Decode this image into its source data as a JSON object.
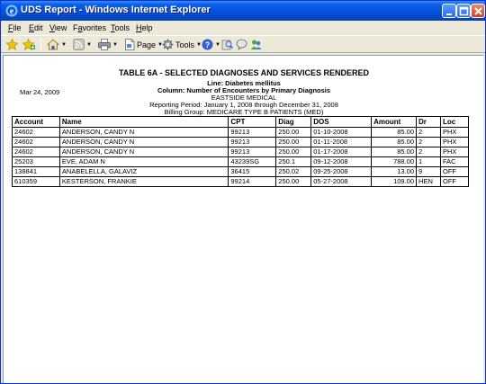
{
  "window": {
    "title": "UDS Report - Windows Internet Explorer"
  },
  "menu": {
    "items": [
      {
        "accel": "F",
        "rest": "ile"
      },
      {
        "accel": "E",
        "rest": "dit"
      },
      {
        "accel": "V",
        "rest": "iew"
      },
      {
        "pre": "F",
        "accel": "a",
        "rest": "vorites"
      },
      {
        "accel": "T",
        "rest": "ools"
      },
      {
        "accel": "H",
        "rest": "elp"
      }
    ]
  },
  "toolbar": {
    "page_label": "Page",
    "tools_label": "Tools"
  },
  "report": {
    "title": "TABLE 6A - SELECTED DIAGNOSES AND SERVICES RENDERED",
    "line": "Line: Diabetes mellitus",
    "column": "Column: Number of Encounters by Primary Diagnosis",
    "org": "EASTSIDE MEDICAL",
    "period": "Reporting Period: January 1, 2008 through December 31, 2008",
    "billing_group": "Billing Group: MEDICARE TYPE B PATIENTS (MED)",
    "date": "Mar 24, 2009",
    "columns": [
      "Account",
      "Name",
      "CPT",
      "Diag",
      "DOS",
      "Amount",
      "Dr",
      "Loc"
    ],
    "rows": [
      [
        "24602",
        "ANDERSON, CANDY N",
        "99213",
        "250.00",
        "01-10-2008",
        "85.00",
        "2",
        "PHX"
      ],
      [
        "24602",
        "ANDERSON, CANDY N",
        "99213",
        "250.00",
        "01-11-2008",
        "85.00",
        "2",
        "PHX"
      ],
      [
        "24602",
        "ANDERSON, CANDY N",
        "99213",
        "250.00",
        "01-17-2008",
        "85.00",
        "2",
        "PHX"
      ],
      [
        "25203",
        "EVE, ADAM N",
        "43239SG",
        "250.1",
        "09-12-2008",
        "788.00",
        "1",
        "FAC"
      ],
      [
        "138841",
        "ANABELELLA, GALAVIZ",
        "36415",
        "250.02",
        "09-25-2008",
        "13.00",
        "9",
        "OFF"
      ],
      [
        "610359",
        "KESTERSON, FRANKIE",
        "99214",
        "250.00",
        "05-27-2008",
        "109.00",
        "HEN",
        "OFF"
      ]
    ]
  }
}
